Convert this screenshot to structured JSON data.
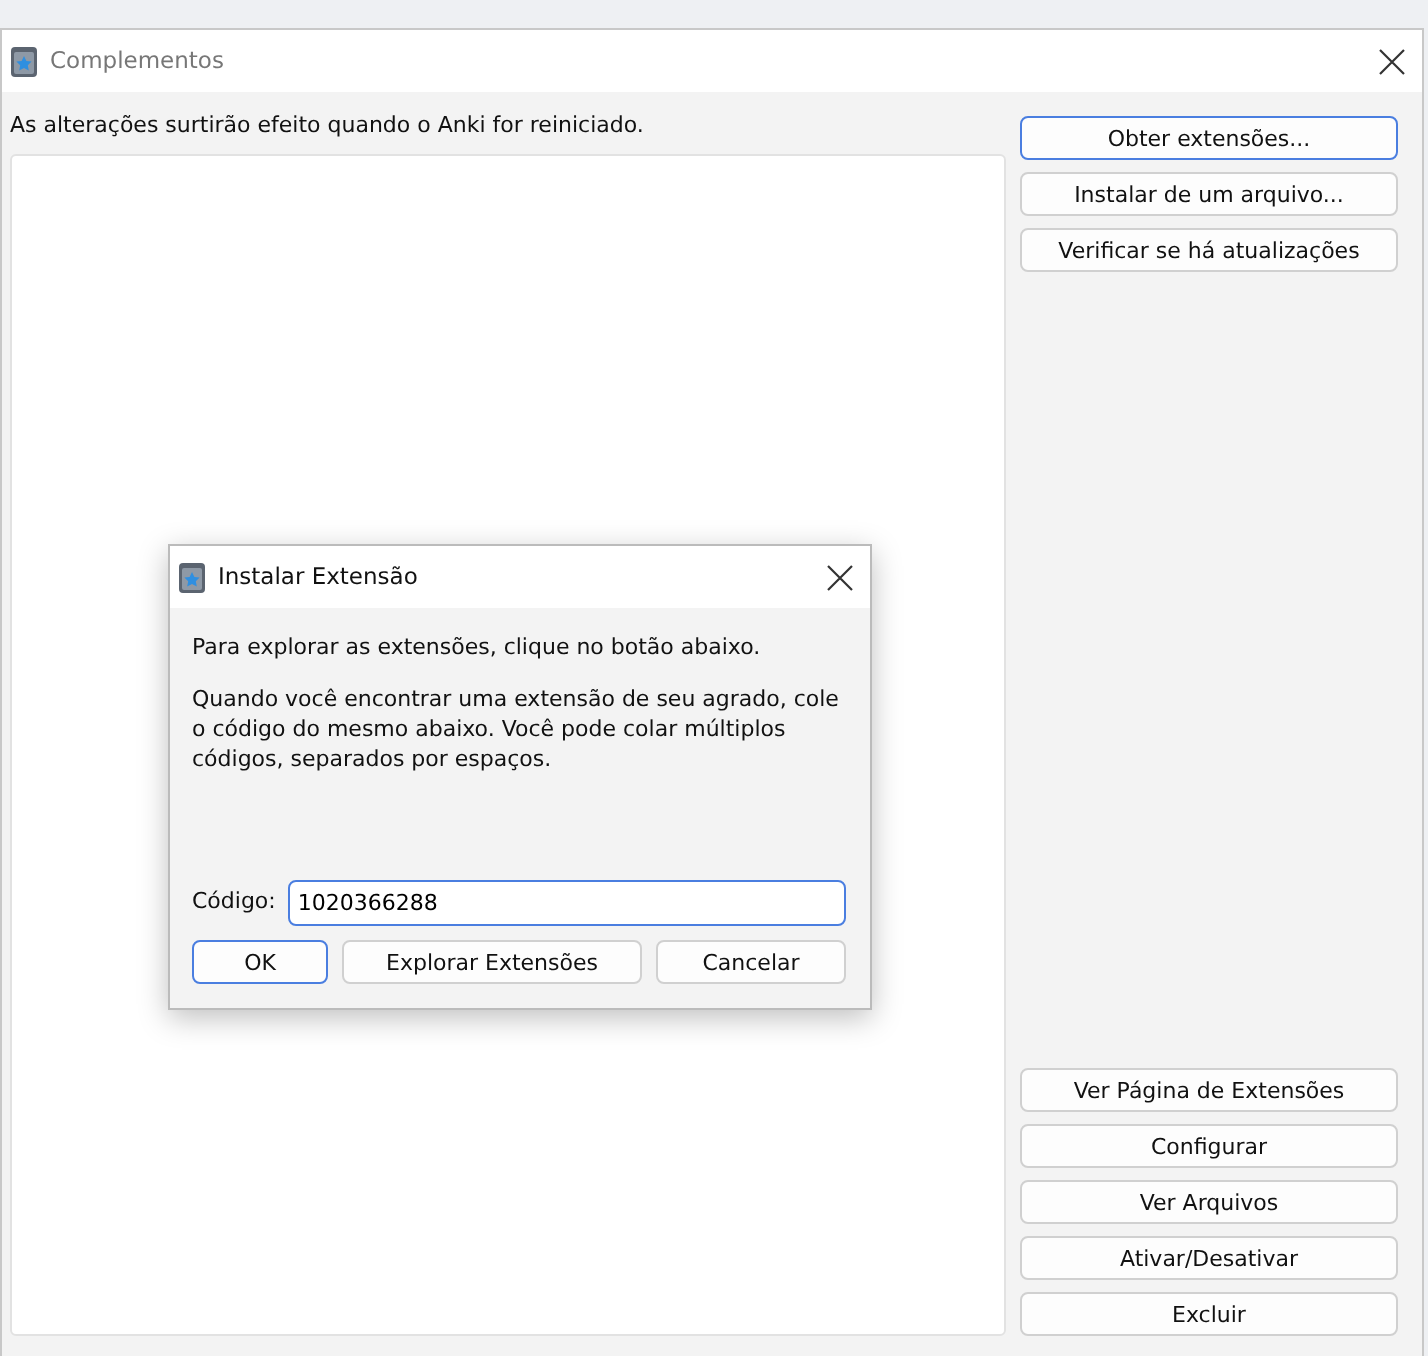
{
  "window": {
    "title": "Complementos"
  },
  "notice": "As alterações surtirão efeito quando o Anki for reiniciado.",
  "top_buttons": [
    {
      "label": "Obter extensões...",
      "default": true
    },
    {
      "label": "Instalar de um arquivo...",
      "default": false
    },
    {
      "label": "Verificar se há atualizações",
      "default": false
    }
  ],
  "bottom_buttons": [
    {
      "label": "Ver Página de Extensões",
      "default": false
    },
    {
      "label": "Configurar",
      "default": false
    },
    {
      "label": "Ver Arquivos",
      "default": false
    },
    {
      "label": "Ativar/Desativar",
      "default": false
    },
    {
      "label": "Excluir",
      "default": false
    }
  ],
  "dialog": {
    "title": "Instalar Extensão",
    "intro": "Para explorar as extensões, clique no botão abaixo.",
    "instructions": "Quando você encontrar uma extensão de seu agrado, cole o código do mesmo abaixo. Você pode colar múltiplos códigos, separados por espaços.",
    "code_label": "Código:",
    "code_value": "1020366288",
    "buttons": [
      {
        "label": "OK",
        "default": true
      },
      {
        "label": "Explorar Extensões",
        "default": false
      },
      {
        "label": "Cancelar",
        "default": false
      }
    ]
  }
}
